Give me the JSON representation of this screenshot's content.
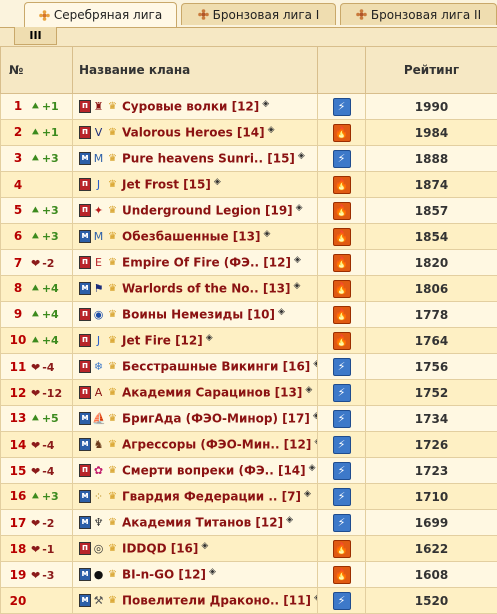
{
  "tabs": [
    {
      "label": "Серебряная лига",
      "active": true
    },
    {
      "label": "Бронзовая лига I",
      "active": false
    },
    {
      "label": "Бронзовая лига II",
      "active": false
    }
  ],
  "subtab": "III",
  "headers": {
    "num": "№",
    "name": "Название клана",
    "rating": "Рейтинг"
  },
  "rows": [
    {
      "rank": "1",
      "delta": "+1",
      "dir": "up",
      "badge": "п",
      "emblem": "castle",
      "name": "Суровые волки [12]",
      "type": "lightning",
      "rating": "1990"
    },
    {
      "rank": "2",
      "delta": "+1",
      "dir": "up",
      "badge": "п",
      "emblem": "v",
      "name": "Valorous Heroes [14]",
      "type": "fire",
      "rating": "1984"
    },
    {
      "rank": "3",
      "delta": "+3",
      "dir": "up",
      "badge": "м",
      "emblem": "m",
      "name": "Pure heavens Sunri.. [15]",
      "type": "lightning",
      "rating": "1888"
    },
    {
      "rank": "4",
      "delta": "",
      "dir": "",
      "badge": "п",
      "emblem": "j",
      "name": "Jet Frost [15]",
      "type": "fire",
      "rating": "1874"
    },
    {
      "rank": "5",
      "delta": "+3",
      "dir": "up",
      "badge": "п",
      "emblem": "star",
      "name": "Underground Legion [19]",
      "type": "fire",
      "rating": "1857"
    },
    {
      "rank": "6",
      "delta": "+3",
      "dir": "up",
      "badge": "м",
      "emblem": "m",
      "name": "Обезбашенные [13]",
      "type": "fire",
      "rating": "1854"
    },
    {
      "rank": "7",
      "delta": "-2",
      "dir": "down",
      "badge": "п",
      "emblem": "e",
      "name": "Empire Of Fire (ФЭ.. [12]",
      "type": "fire",
      "rating": "1820"
    },
    {
      "rank": "8",
      "delta": "+4",
      "dir": "up",
      "badge": "м",
      "emblem": "flag",
      "name": "Warlords of the No.. [13]",
      "type": "fire",
      "rating": "1806"
    },
    {
      "rank": "9",
      "delta": "+4",
      "dir": "up",
      "badge": "п",
      "emblem": "circle",
      "name": "Воины Немезиды [10]",
      "type": "fire",
      "rating": "1778"
    },
    {
      "rank": "10",
      "delta": "+4",
      "dir": "up",
      "badge": "п",
      "emblem": "j",
      "name": "Jet Fire [12]",
      "type": "fire",
      "rating": "1764"
    },
    {
      "rank": "11",
      "delta": "-4",
      "dir": "down",
      "badge": "п",
      "emblem": "snow",
      "name": "Бесстрашные Викинги [16]",
      "type": "lightning",
      "rating": "1756"
    },
    {
      "rank": "12",
      "delta": "-12",
      "dir": "down",
      "badge": "п",
      "emblem": "a",
      "name": "Академия Сарацинов [13]",
      "type": "lightning",
      "rating": "1752"
    },
    {
      "rank": "13",
      "delta": "+5",
      "dir": "up",
      "badge": "м",
      "emblem": "ship",
      "name": "БригАда (ФЭО-Минор) [17]",
      "type": "lightning",
      "rating": "1734"
    },
    {
      "rank": "14",
      "delta": "-4",
      "dir": "down",
      "badge": "м",
      "emblem": "beast",
      "name": "Агрессоры (ФЭО-Мин.. [12]",
      "type": "lightning",
      "rating": "1726"
    },
    {
      "rank": "15",
      "delta": "-4",
      "dir": "down",
      "badge": "п",
      "emblem": "flower",
      "name": "Смерти вопреки (ФЭ.. [14]",
      "type": "lightning",
      "rating": "1723"
    },
    {
      "rank": "16",
      "delta": "+3",
      "dir": "up",
      "badge": "м",
      "emblem": "dots",
      "name": "Гвардия Федерации .. [7]",
      "type": "lightning",
      "rating": "1710"
    },
    {
      "rank": "17",
      "delta": "-2",
      "dir": "down",
      "badge": "м",
      "emblem": "titan",
      "name": "Академия Титанов [12]",
      "type": "lightning",
      "rating": "1699"
    },
    {
      "rank": "18",
      "delta": "-1",
      "dir": "down",
      "badge": "п",
      "emblem": "spiral",
      "name": "IDDQD [16]",
      "type": "fire",
      "rating": "1622"
    },
    {
      "rank": "19",
      "delta": "-3",
      "dir": "down",
      "badge": "м",
      "emblem": "ball",
      "name": "BI-n-GO [12]",
      "type": "fire",
      "rating": "1608"
    },
    {
      "rank": "20",
      "delta": "",
      "dir": "",
      "badge": "м",
      "emblem": "tools",
      "name": "Повелители Драконо.. [11]",
      "type": "lightning",
      "rating": "1520"
    }
  ],
  "colors": {
    "rank": "#B80000",
    "up": "#3C8A1E",
    "down": "#8B1A1A",
    "clan": "#8B1212",
    "row_odd": "#FFF8E2",
    "row_even": "#FEF0C4"
  }
}
